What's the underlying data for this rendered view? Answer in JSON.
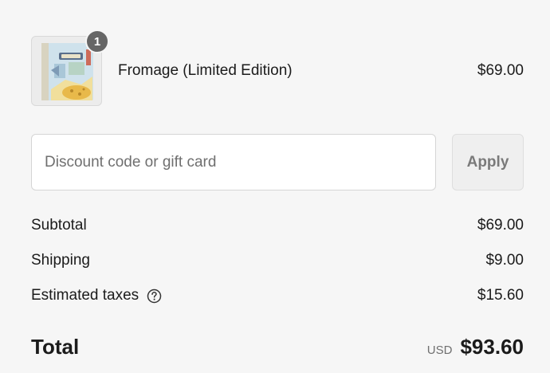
{
  "product": {
    "name": "Fromage (Limited Edition)",
    "price": "$69.00",
    "quantity": "1",
    "image_icon": "board-game-box-image"
  },
  "discount": {
    "placeholder": "Discount code or gift card",
    "value": "",
    "apply_label": "Apply"
  },
  "summary": {
    "subtotal_label": "Subtotal",
    "subtotal_value": "$69.00",
    "shipping_label": "Shipping",
    "shipping_value": "$9.00",
    "taxes_label": "Estimated taxes",
    "taxes_value": "$15.60",
    "taxes_help_icon": "question-circle-icon"
  },
  "total": {
    "label": "Total",
    "currency": "USD",
    "amount": "$93.60"
  },
  "colors": {
    "background": "#f6f6f6",
    "badge": "#666666",
    "apply_button_bg": "#efefef",
    "apply_button_text": "#7a7a7a"
  }
}
